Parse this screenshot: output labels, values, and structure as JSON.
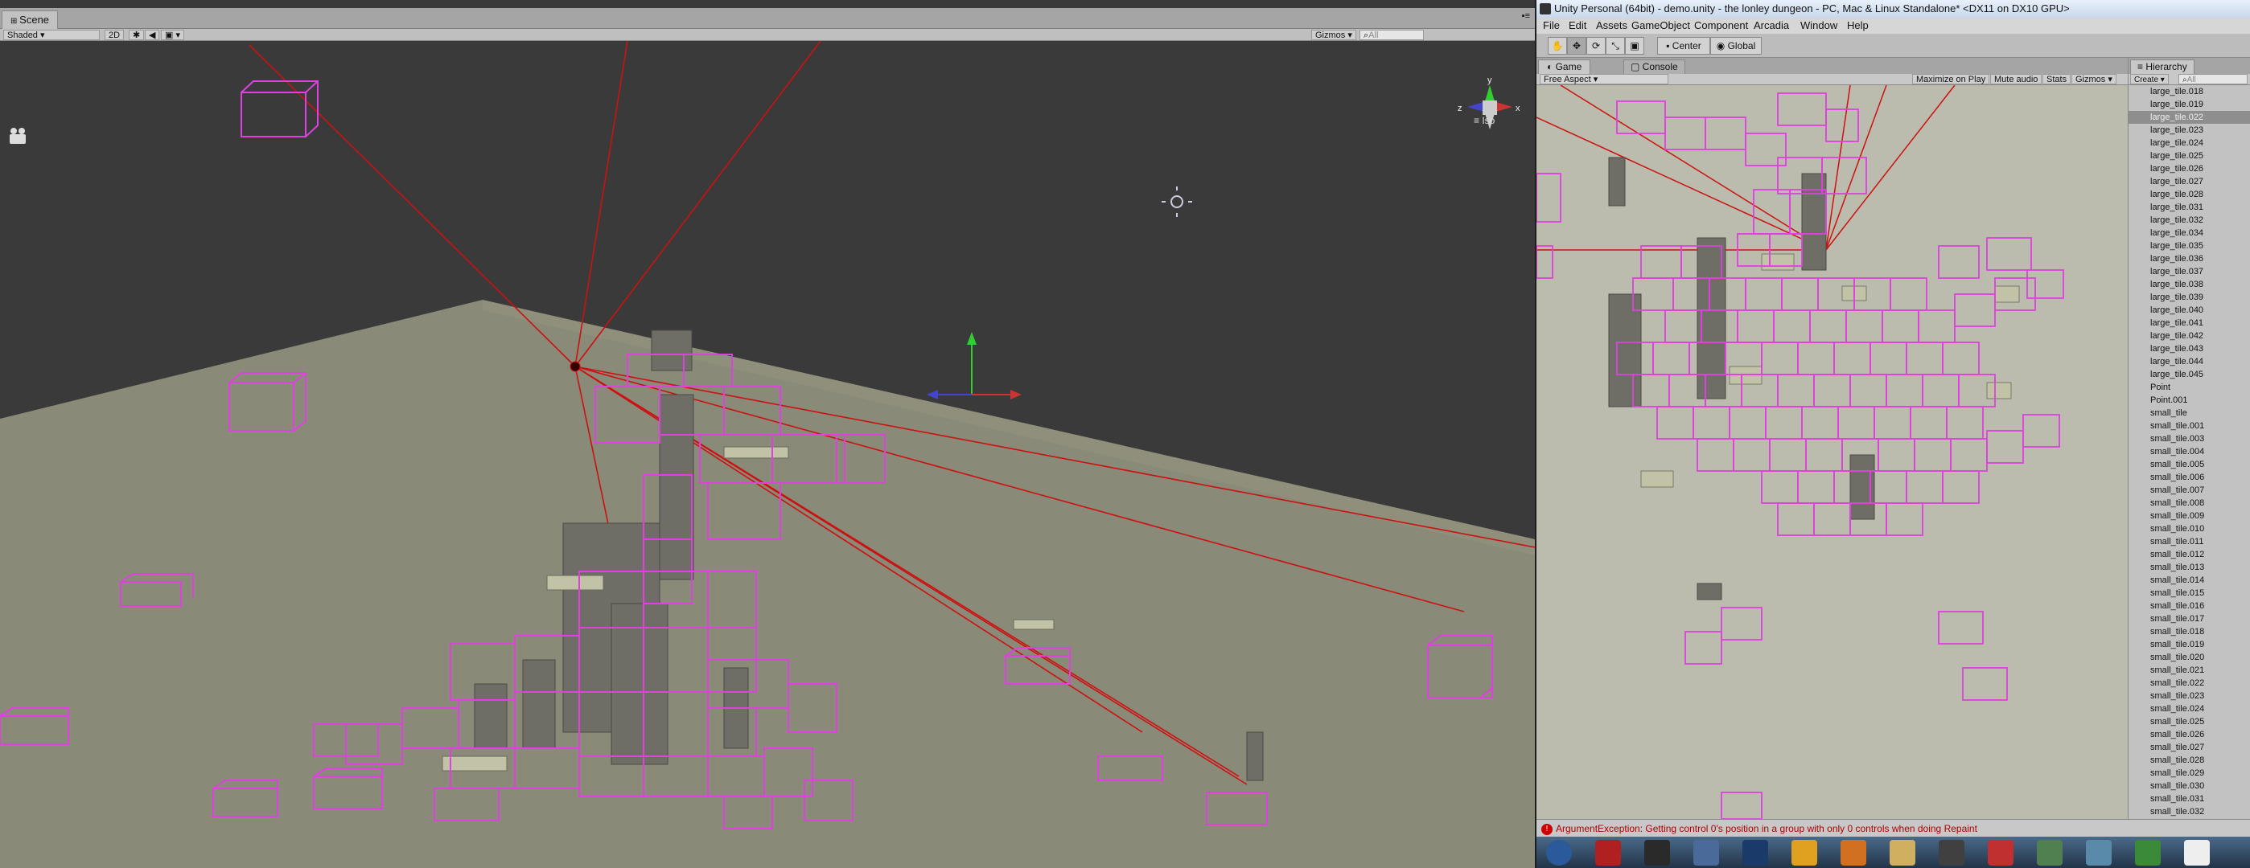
{
  "scene": {
    "tab_label": "Scene",
    "shading_mode": "Shaded",
    "toolbar_2d": "2D",
    "gizmos_label": "Gizmos",
    "search_placeholder": "All",
    "projection_label": "Iso"
  },
  "window": {
    "title": "Unity Personal (64bit) - demo.unity - the lonley dungeon - PC, Mac & Linux Standalone* <DX11 on DX10 GPU>"
  },
  "menu": [
    "File",
    "Edit",
    "Assets",
    "GameObject",
    "Component",
    "Arcadia",
    "Window",
    "Help"
  ],
  "toolbar": {
    "pivot_label": "Center",
    "space_label": "Global"
  },
  "game": {
    "tab_label": "Game",
    "console_tab_label": "Console",
    "aspect_label": "Free Aspect",
    "maximize_label": "Maximize on Play",
    "mute_label": "Mute audio",
    "stats_label": "Stats",
    "gizmos_label": "Gizmos"
  },
  "hierarchy": {
    "tab_label": "Hierarchy",
    "create_label": "Create",
    "search_placeholder": "All",
    "selected_index": 2,
    "items": [
      "large_tile.018",
      "large_tile.019",
      "large_tile.022",
      "large_tile.023",
      "large_tile.024",
      "large_tile.025",
      "large_tile.026",
      "large_tile.027",
      "large_tile.028",
      "large_tile.031",
      "large_tile.032",
      "large_tile.034",
      "large_tile.035",
      "large_tile.036",
      "large_tile.037",
      "large_tile.038",
      "large_tile.039",
      "large_tile.040",
      "large_tile.041",
      "large_tile.042",
      "large_tile.043",
      "large_tile.044",
      "large_tile.045",
      "Point",
      "Point.001",
      "small_tile",
      "small_tile.001",
      "small_tile.003",
      "small_tile.004",
      "small_tile.005",
      "small_tile.006",
      "small_tile.007",
      "small_tile.008",
      "small_tile.009",
      "small_tile.010",
      "small_tile.011",
      "small_tile.012",
      "small_tile.013",
      "small_tile.014",
      "small_tile.015",
      "small_tile.016",
      "small_tile.017",
      "small_tile.018",
      "small_tile.019",
      "small_tile.020",
      "small_tile.021",
      "small_tile.022",
      "small_tile.023",
      "small_tile.024",
      "small_tile.025",
      "small_tile.026",
      "small_tile.027",
      "small_tile.028",
      "small_tile.029",
      "small_tile.030",
      "small_tile.031",
      "small_tile.032"
    ]
  },
  "status": {
    "message": "ArgumentException: Getting control 0's position in a group with only 0 controls when doing Repaint"
  },
  "taskbar": {
    "icons": [
      "start-orb-icon",
      "filezilla-icon",
      "steam-icon",
      "explorer-icon",
      "photoshop-icon",
      "cinema-icon",
      "blender-icon",
      "folder-icon",
      "sublime-icon",
      "media-icon",
      "monitor-icon",
      "window-icon",
      "chrome-icon",
      "unity-icon"
    ]
  },
  "colors": {
    "wireframe": "#e040e0",
    "ray": "#cc1111",
    "floor": "#8a8a78",
    "sky": "#3a3a3a"
  }
}
